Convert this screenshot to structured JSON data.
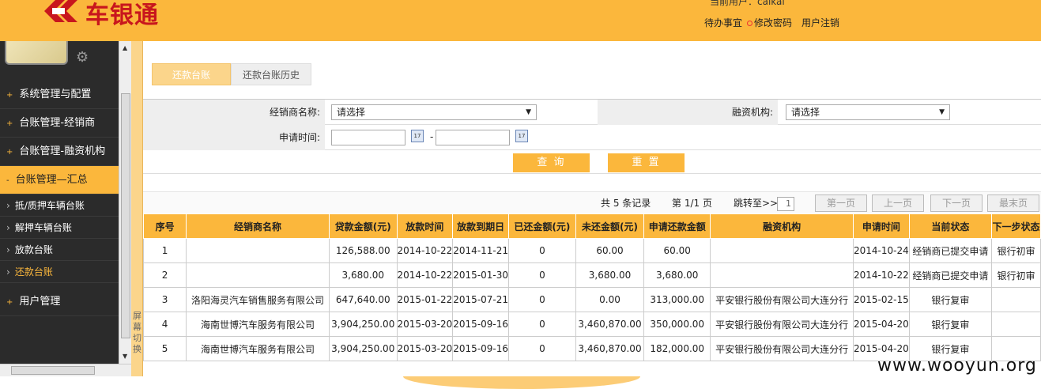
{
  "header": {
    "logo_text": "车银通",
    "user_line": "当前用户：caikai",
    "links": [
      "待办事宜",
      "修改密码",
      "用户注销"
    ],
    "bg_color": "#fbb73c",
    "logo_color": "#c8161d"
  },
  "sidebar": {
    "items": [
      {
        "label": "系统管理与配置",
        "marker": "+"
      },
      {
        "label": "台账管理-经销商",
        "marker": "+"
      },
      {
        "label": "台账管理-融资机构",
        "marker": "+"
      },
      {
        "label": "台账管理—汇总",
        "marker": "-"
      }
    ],
    "subitems": [
      "抵/质押车辆台账",
      "解押车辆台账",
      "放款台账",
      "还款台账"
    ],
    "last_item": {
      "label": "用户管理",
      "marker": "+"
    },
    "switch_label": "屏幕切换"
  },
  "tabs": [
    "还款台账",
    "还款台账历史"
  ],
  "filter": {
    "dealer_label": "经销商名称:",
    "dealer_value": "请选择",
    "org_label": "融资机构:",
    "org_value": "请选择",
    "date_label": "申请时间:",
    "date_sep": "-",
    "query_btn": "查 询",
    "reset_btn": "重 置"
  },
  "pager": {
    "summary": "共 5 条记录",
    "page": "第 1/1 页",
    "jump_label": "跳转至>>",
    "jump_value": "1",
    "first": "第一页",
    "prev": "上一页",
    "next": "下一页",
    "last": "最末页"
  },
  "table": {
    "headers": [
      "序号",
      "经销商名称",
      "贷款金额(元)",
      "放款时间",
      "放款到期日",
      "已还金额(元)",
      "未还金额(元)",
      "申请还款金额",
      "融资机构",
      "申请时间",
      "当前状态",
      "下一步状态"
    ],
    "rows": [
      [
        "1",
        "",
        "126,588.00",
        "2014-10-22",
        "2014-11-21",
        "0",
        "60.00",
        "60.00",
        "",
        "2014-10-24",
        "经销商已提交申请",
        "银行初审"
      ],
      [
        "2",
        "",
        "3,680.00",
        "2014-10-22",
        "2015-01-30",
        "0",
        "3,680.00",
        "3,680.00",
        "",
        "2014-10-22",
        "经销商已提交申请",
        "银行初审"
      ],
      [
        "3",
        "洛阳海灵汽车销售服务有限公司",
        "647,640.00",
        "2015-01-22",
        "2015-07-21",
        "0",
        "0.00",
        "313,000.00",
        "平安银行股份有限公司大连分行",
        "2015-02-15",
        "银行复审",
        ""
      ],
      [
        "4",
        "海南世博汽车服务有限公司",
        "3,904,250.00",
        "2015-03-20",
        "2015-09-16",
        "0",
        "3,460,870.00",
        "350,000.00",
        "平安银行股份有限公司大连分行",
        "2015-04-20",
        "银行复审",
        ""
      ],
      [
        "5",
        "海南世博汽车服务有限公司",
        "3,904,250.00",
        "2015-03-20",
        "2015-09-16",
        "0",
        "3,460,870.00",
        "182,000.00",
        "平安银行股份有限公司大连分行",
        "2015-04-20",
        "银行复审",
        ""
      ]
    ]
  },
  "watermark": "www.wooyun.org"
}
